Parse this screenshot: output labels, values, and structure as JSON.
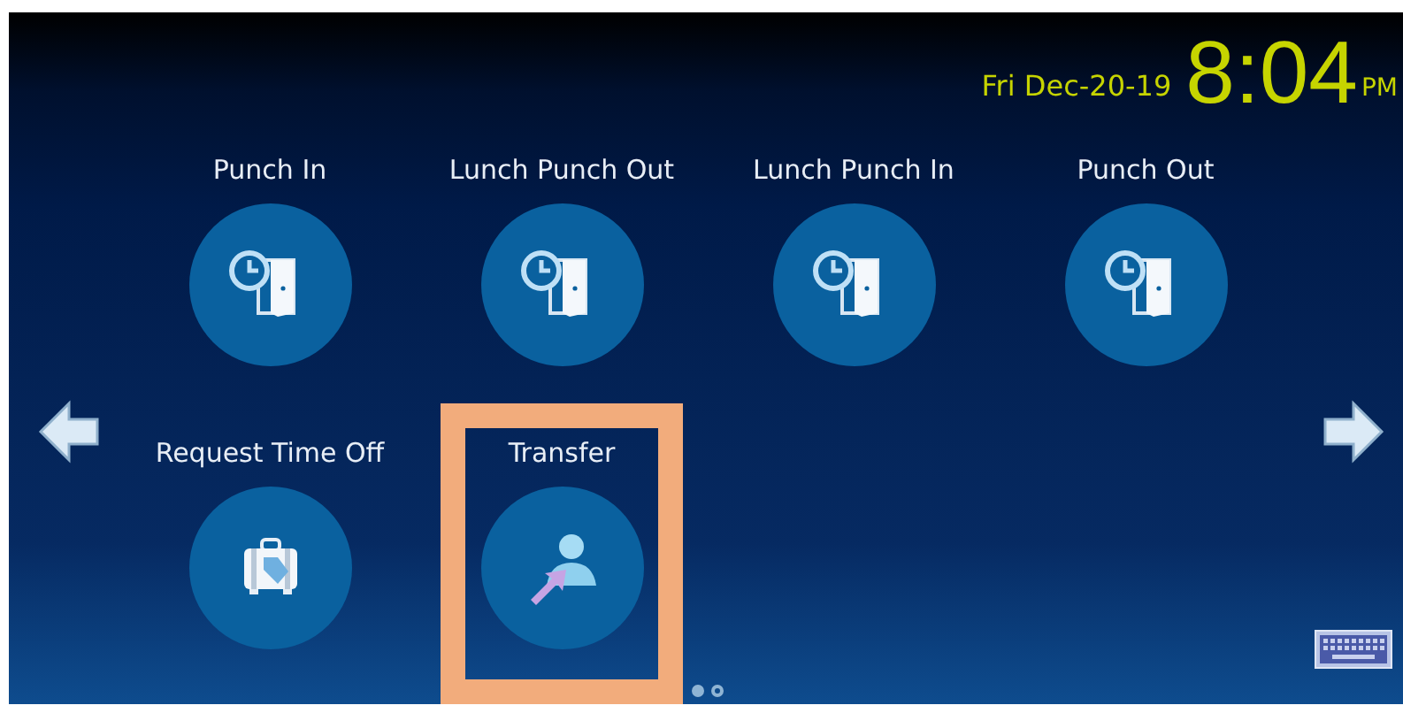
{
  "header": {
    "date": "Fri Dec-20-19",
    "time": "8:04",
    "meridiem": "PM"
  },
  "tiles": [
    {
      "label": "Punch In",
      "kind": "punch",
      "highlighted": false
    },
    {
      "label": "Lunch Punch Out",
      "kind": "punch",
      "highlighted": false
    },
    {
      "label": "Lunch Punch In",
      "kind": "punch",
      "highlighted": false
    },
    {
      "label": "Punch Out",
      "kind": "punch",
      "highlighted": false
    },
    {
      "label": "Request Time Off",
      "kind": "timeoff",
      "highlighted": false
    },
    {
      "label": "Transfer",
      "kind": "transfer",
      "highlighted": true
    }
  ],
  "pages": [
    {
      "selected": true
    },
    {
      "selected": false
    }
  ]
}
